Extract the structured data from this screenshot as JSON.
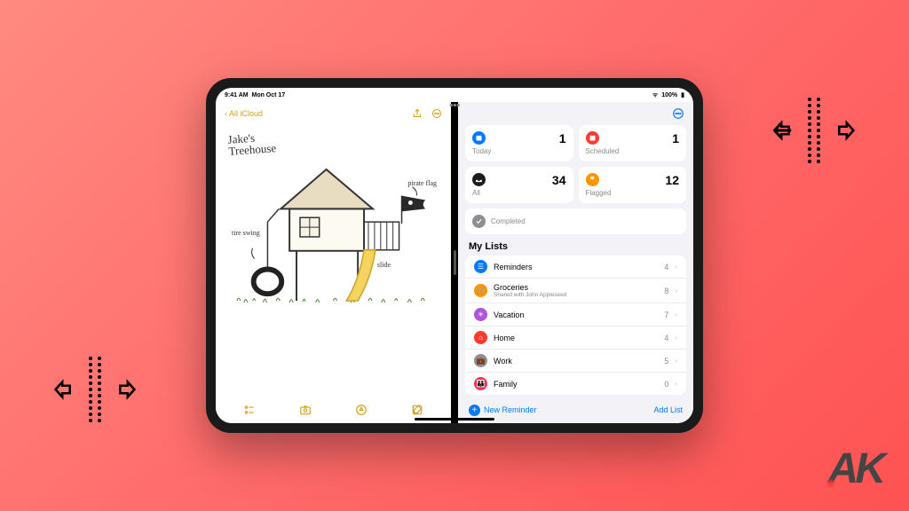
{
  "status": {
    "time": "9:41 AM",
    "date": "Mon Oct 17",
    "battery": "100%"
  },
  "notes": {
    "back_label": "All iCloud",
    "sketch": {
      "title_line1": "Jake's",
      "title_line2": "Treehouse",
      "labels": {
        "tire_swing": "tire\nswing",
        "pirate_flag": "pirate\nflag",
        "slide": "slide"
      }
    }
  },
  "reminders": {
    "smart": {
      "today": {
        "label": "Today",
        "count": "1",
        "color": "#007aff"
      },
      "scheduled": {
        "label": "Scheduled",
        "count": "1",
        "color": "#ff3b30"
      },
      "all": {
        "label": "All",
        "count": "34",
        "color": "#1c1c1e"
      },
      "flagged": {
        "label": "Flagged",
        "count": "12",
        "color": "#ff9500"
      },
      "completed": {
        "label": "Completed",
        "color": "#8e8e93"
      }
    },
    "section_title": "My Lists",
    "lists": [
      {
        "name": "Reminders",
        "count": "4",
        "color": "#007aff",
        "icon": "list"
      },
      {
        "name": "Groceries",
        "sub": "Shared with John Appleseed",
        "count": "8",
        "color": "#ff9500",
        "icon": "cart"
      },
      {
        "name": "Vacation",
        "count": "7",
        "color": "#af52de",
        "icon": "sun"
      },
      {
        "name": "Home",
        "count": "4",
        "color": "#ff3b30",
        "icon": "home"
      },
      {
        "name": "Work",
        "count": "5",
        "color": "#8e8e93",
        "icon": "briefcase"
      },
      {
        "name": "Family",
        "count": "0",
        "color": "#ff2d55",
        "icon": "family"
      }
    ],
    "new_reminder_label": "New Reminder",
    "add_list_label": "Add List"
  },
  "logo": "AK"
}
